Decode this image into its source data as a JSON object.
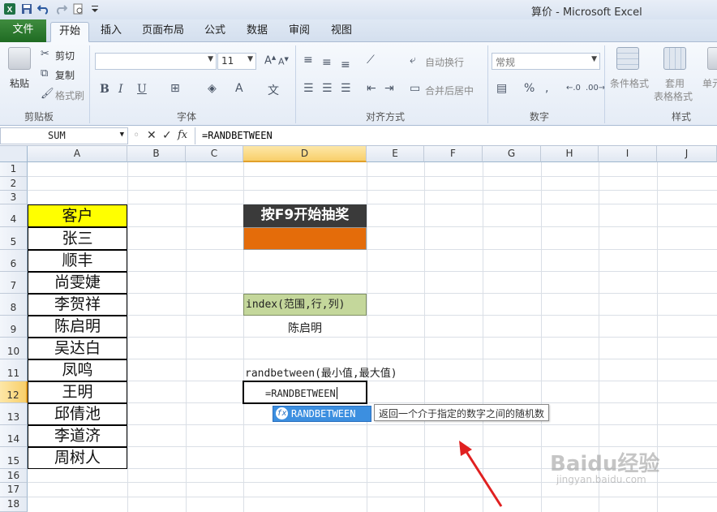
{
  "window": {
    "title": "算价 - Microsoft Excel"
  },
  "tabs": [
    "文件",
    "开始",
    "插入",
    "页面布局",
    "公式",
    "数据",
    "审阅",
    "视图"
  ],
  "active_tab": "开始",
  "ribbon": {
    "clipboard": {
      "paste": "粘贴",
      "cut": "剪切",
      "copy": "复制",
      "format_painter": "格式刷",
      "label": "剪贴板"
    },
    "font": {
      "size": "11",
      "label": "字体"
    },
    "alignment": {
      "wrap": "自动换行",
      "merge": "合并后居中",
      "label": "对齐方式"
    },
    "number": {
      "format": "常规",
      "label": "数字"
    },
    "styles": {
      "conditional": "条件格式",
      "table_line1": "套用",
      "table_line2": "表格格式",
      "cell": "单元",
      "label": "样式"
    }
  },
  "formula_bar": {
    "name_box": "SUM",
    "formula": "=RANDBETWEEN",
    "fx": "fx"
  },
  "columns": [
    "A",
    "B",
    "C",
    "D",
    "E",
    "F",
    "G",
    "H",
    "I",
    "J"
  ],
  "rows": [
    "1",
    "2",
    "3",
    "4",
    "5",
    "6",
    "7",
    "8",
    "9",
    "10",
    "11",
    "12",
    "13",
    "14",
    "15",
    "16",
    "17",
    "18"
  ],
  "customers": {
    "header": "客户",
    "names": [
      "张三",
      "顺丰",
      "尚雯婕",
      "李贺祥",
      "陈启明",
      "吴达白",
      "凤鸣",
      "王明",
      "邱倩池",
      "李道济",
      "周树人"
    ]
  },
  "draw": {
    "title": "按F9开始抽奖"
  },
  "index_formula": "index(范围,行,列)",
  "index_result": "陈启明",
  "randbetween_label": "randbetween(最小值,最大值)",
  "editing_cell": "=RANDBETWEEN",
  "autocomplete": {
    "item": "RANDBETWEEN",
    "tooltip": "返回一个介于指定的数字之间的随机数"
  },
  "watermark": {
    "text": "Baidu经验",
    "sub": "jingyan.baidu.com"
  },
  "colors": {
    "header_fill": "#ffff00",
    "draw_title_fill": "#3a3a3a",
    "draw_result_fill": "#e46c0a",
    "index_fill": "#c4d79b",
    "accent_arrow": "#e02020"
  }
}
